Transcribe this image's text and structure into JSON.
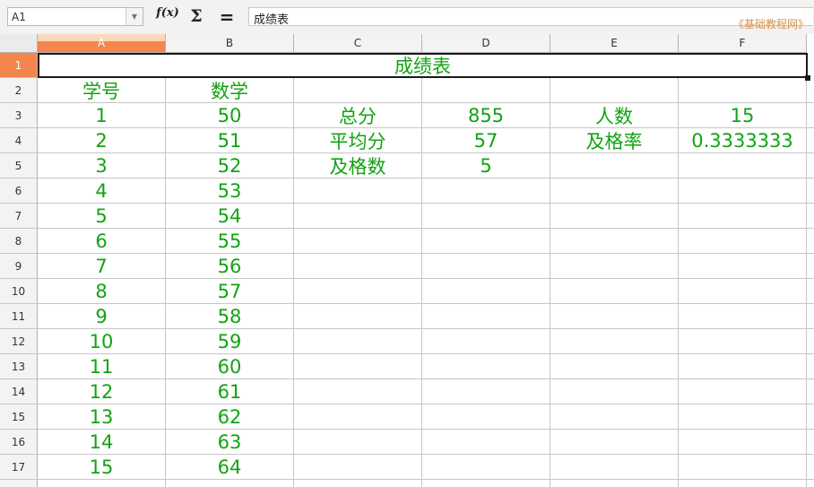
{
  "formula_bar": {
    "name_box": "A1",
    "fx_label": "f(x)",
    "sum_label": "Σ",
    "equals_label": "=",
    "content": "成绩表"
  },
  "watermark": "《基础教程网》",
  "sheet": {
    "columns": [
      "A",
      "B",
      "C",
      "D",
      "E",
      "F"
    ],
    "rows": [
      "1",
      "2",
      "3",
      "4",
      "5",
      "6",
      "7",
      "8",
      "9",
      "10",
      "11",
      "12",
      "13",
      "14",
      "15",
      "16",
      "17"
    ],
    "selected_column": "A",
    "selected_row": "1",
    "title": "成绩表",
    "cells": [
      [
        "学号",
        "数学",
        "",
        "",
        "",
        ""
      ],
      [
        "1",
        "50",
        "总分",
        "855",
        "人数",
        "15"
      ],
      [
        "2",
        "51",
        "平均分",
        "57",
        "及格率",
        "0.3333333"
      ],
      [
        "3",
        "52",
        "及格数",
        "5",
        "",
        ""
      ],
      [
        "4",
        "53",
        "",
        "",
        "",
        ""
      ],
      [
        "5",
        "54",
        "",
        "",
        "",
        ""
      ],
      [
        "6",
        "55",
        "",
        "",
        "",
        ""
      ],
      [
        "7",
        "56",
        "",
        "",
        "",
        ""
      ],
      [
        "8",
        "57",
        "",
        "",
        "",
        ""
      ],
      [
        "9",
        "58",
        "",
        "",
        "",
        ""
      ],
      [
        "10",
        "59",
        "",
        "",
        "",
        ""
      ],
      [
        "11",
        "60",
        "",
        "",
        "",
        ""
      ],
      [
        "12",
        "61",
        "",
        "",
        "",
        ""
      ],
      [
        "13",
        "62",
        "",
        "",
        "",
        ""
      ],
      [
        "14",
        "63",
        "",
        "",
        "",
        ""
      ],
      [
        "15",
        "64",
        "",
        "",
        "",
        ""
      ]
    ],
    "text_color": "#12a312",
    "accent_color": "#f3864c"
  }
}
